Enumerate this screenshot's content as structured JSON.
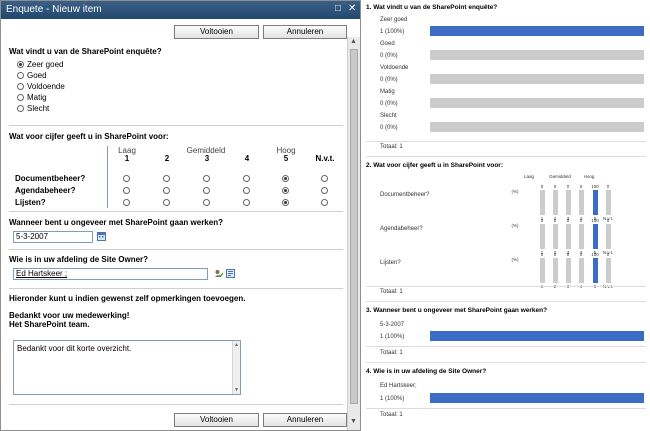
{
  "dialog": {
    "title": "Enquete - Nieuw item",
    "ok_label": "Voltooien",
    "cancel_label": "Annuleren",
    "q1": {
      "label": "Wat vindt u van de SharePoint enquête?",
      "options": [
        "Zeer goed",
        "Goed",
        "Voldoende",
        "Matig",
        "Slecht"
      ],
      "selected": 0
    },
    "q2": {
      "label": "Wat voor cijfer geeft u in SharePoint voor:",
      "headers": [
        "Laag",
        "Gemiddeld",
        "Hoog"
      ],
      "columns": [
        "1",
        "2",
        "3",
        "4",
        "5",
        "N.v.t."
      ],
      "rows": [
        {
          "label": "Documentbeheer?",
          "selected": 4
        },
        {
          "label": "Agendabeheer?",
          "selected": 4
        },
        {
          "label": "Lijsten?",
          "selected": 4
        }
      ]
    },
    "q3": {
      "label": "Wanneer bent u ongeveer met SharePoint gaan werken?",
      "value": "5-3-2007"
    },
    "q4": {
      "label": "Wie is in uw afdeling de Site Owner?",
      "value": "Ed Hartskeer ;"
    },
    "q5": {
      "label": "Hieronder kunt u indien gewenst zelf opmerkingen toevoegen.",
      "thanks1": "Bedankt voor uw medewerking!",
      "thanks2": "Het SharePoint team.",
      "value": "Bedankt voor dit korte overzicht."
    }
  },
  "results": {
    "q1": {
      "label": "1. Wat vindt u van de SharePoint enquête?",
      "rows": [
        {
          "label": "Zeer goed",
          "value": "1 (100%)",
          "fraction": 1
        },
        {
          "label": "Goed",
          "value": "0 (0%)",
          "fraction": 0
        },
        {
          "label": "Voldoende",
          "value": "0 (0%)",
          "fraction": 0
        },
        {
          "label": "Matig",
          "value": "0 (0%)",
          "fraction": 0
        },
        {
          "label": "Slecht",
          "value": "0 (0%)",
          "fraction": 0
        }
      ],
      "total": "Totaal: 1"
    },
    "q2": {
      "label": "2. Wat voor cijfer geeft u in SharePoint voor:",
      "headers": [
        "Laag",
        "Gemiddeld",
        "Hoog"
      ],
      "cols": [
        "1",
        "2",
        "3",
        "4",
        "5",
        "N.v.t."
      ],
      "pct": "(%)",
      "rows": [
        {
          "label": "Documentbeheer?",
          "values": [
            "0",
            "0",
            "0",
            "0",
            "100",
            "0"
          ]
        },
        {
          "label": "Agendabeheer?",
          "values": [
            "0",
            "0",
            "0",
            "0",
            "100",
            "0"
          ]
        },
        {
          "label": "Lijsten?",
          "values": [
            "0",
            "0",
            "0",
            "0",
            "100",
            "0"
          ]
        }
      ],
      "total": "Totaal: 1"
    },
    "q3": {
      "label": "3. Wanneer bent u ongeveer met SharePoint gaan werken?",
      "row_label": "5-3-2007",
      "value": "1 (100%)",
      "fraction": 1,
      "total": "Totaal: 1"
    },
    "q4": {
      "label": "4. Wie is in uw afdeling de Site Owner?",
      "row_label": "Ed Hartskeer;",
      "value": "1 (100%)",
      "fraction": 1,
      "total": "Totaal: 1"
    }
  },
  "colors": {
    "bar": "#3c6cc4",
    "bar_bg": "#cccccc",
    "titlebar": "#2b4f78"
  }
}
